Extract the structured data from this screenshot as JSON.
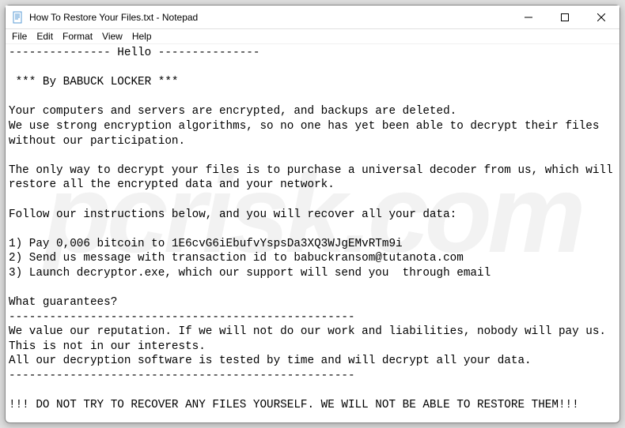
{
  "titlebar": {
    "title": "How To Restore Your Files.txt - Notepad"
  },
  "menubar": {
    "file": "File",
    "edit": "Edit",
    "format": "Format",
    "view": "View",
    "help": "Help"
  },
  "document": {
    "body": "--------------- Hello ---------------\n\n *** By BABUCK LOCKER ***\n\nYour computers and servers are encrypted, and backups are deleted.\nWe use strong encryption algorithms, so no one has yet been able to decrypt their files without our participation.\n\nThe only way to decrypt your files is to purchase a universal decoder from us, which will restore all the encrypted data and your network.\n\nFollow our instructions below, and you will recover all your data:\n\n1) Pay 0,006 bitcoin to 1E6cvG6iEbufvYspsDa3XQ3WJgEMvRTm9i\n2) Send us message with transaction id to babuckransom@tutanota.com\n3) Launch decryptor.exe, which our support will send you  through email\n\nWhat guarantees?\n---------------------------------------------------\nWe value our reputation. If we will not do our work and liabilities, nobody will pay us. This is not in our interests.\nAll our decryption software is tested by time and will decrypt all your data.\n---------------------------------------------------\n\n!!! DO NOT TRY TO RECOVER ANY FILES YOURSELF. WE WILL NOT BE ABLE TO RESTORE THEM!!!"
  },
  "watermark": {
    "text": "pcrisk.com"
  }
}
